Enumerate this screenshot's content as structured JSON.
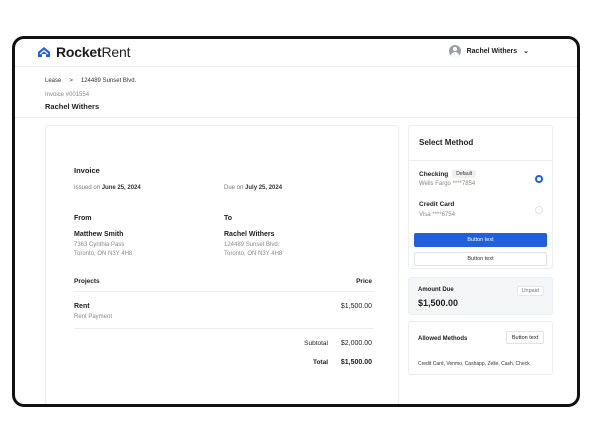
{
  "app": {
    "brand_bold": "Rocket",
    "brand_light": "Rent",
    "brand_color": "#1f5fe0"
  },
  "user": {
    "name": "Rachel Withers"
  },
  "breadcrumb": {
    "item1": "Lease",
    "separator": ">",
    "item2": "124489 Sunset Blvd."
  },
  "header": {
    "invoice_number": "Invoice #001554",
    "tenant_name": "Rachel Withers"
  },
  "invoice": {
    "title": "Invoice",
    "issued_label": "Issued on",
    "issued_date": "June 25, 2024",
    "due_label": "Due on",
    "due_date": "July 25, 2024",
    "from_label": "From",
    "to_label": "To",
    "from": {
      "name": "Matthew Smith",
      "address1": "7363 Cynthia Pass",
      "address2": "Toronto, ON N3Y 4H8"
    },
    "to": {
      "name": "Rachel Withers",
      "address1": "124489 Sunset Blvd.",
      "address2": "Toronto, ON N3Y 4H8"
    },
    "columns": {
      "projects": "Projects",
      "price": "Price"
    },
    "items": [
      {
        "name": "Rent",
        "desc": "Rent Payment",
        "price": "$1,500.00"
      }
    ],
    "subtotal_label": "Subtotal",
    "subtotal": "$2,000.00",
    "total_label": "Total",
    "total": "$1,500.00"
  },
  "select_method": {
    "title": "Select Method",
    "methods": [
      {
        "name": "Checking",
        "badge": "Default",
        "detail": "Wells Fargo ****7854",
        "selected": true
      },
      {
        "name": "Credit Card",
        "detail": "Visa ****6754",
        "selected": false
      }
    ],
    "primary_button": "Button text",
    "secondary_button": "Button text"
  },
  "amount_due": {
    "label": "Amount Due",
    "value": "$1,500.00",
    "status": "Unpaid"
  },
  "allowed_methods": {
    "title": "Allowed Methods",
    "button": "Button text",
    "list": "Credit Card, Venmo, Cashapp, Zelle, Cash, Check"
  }
}
